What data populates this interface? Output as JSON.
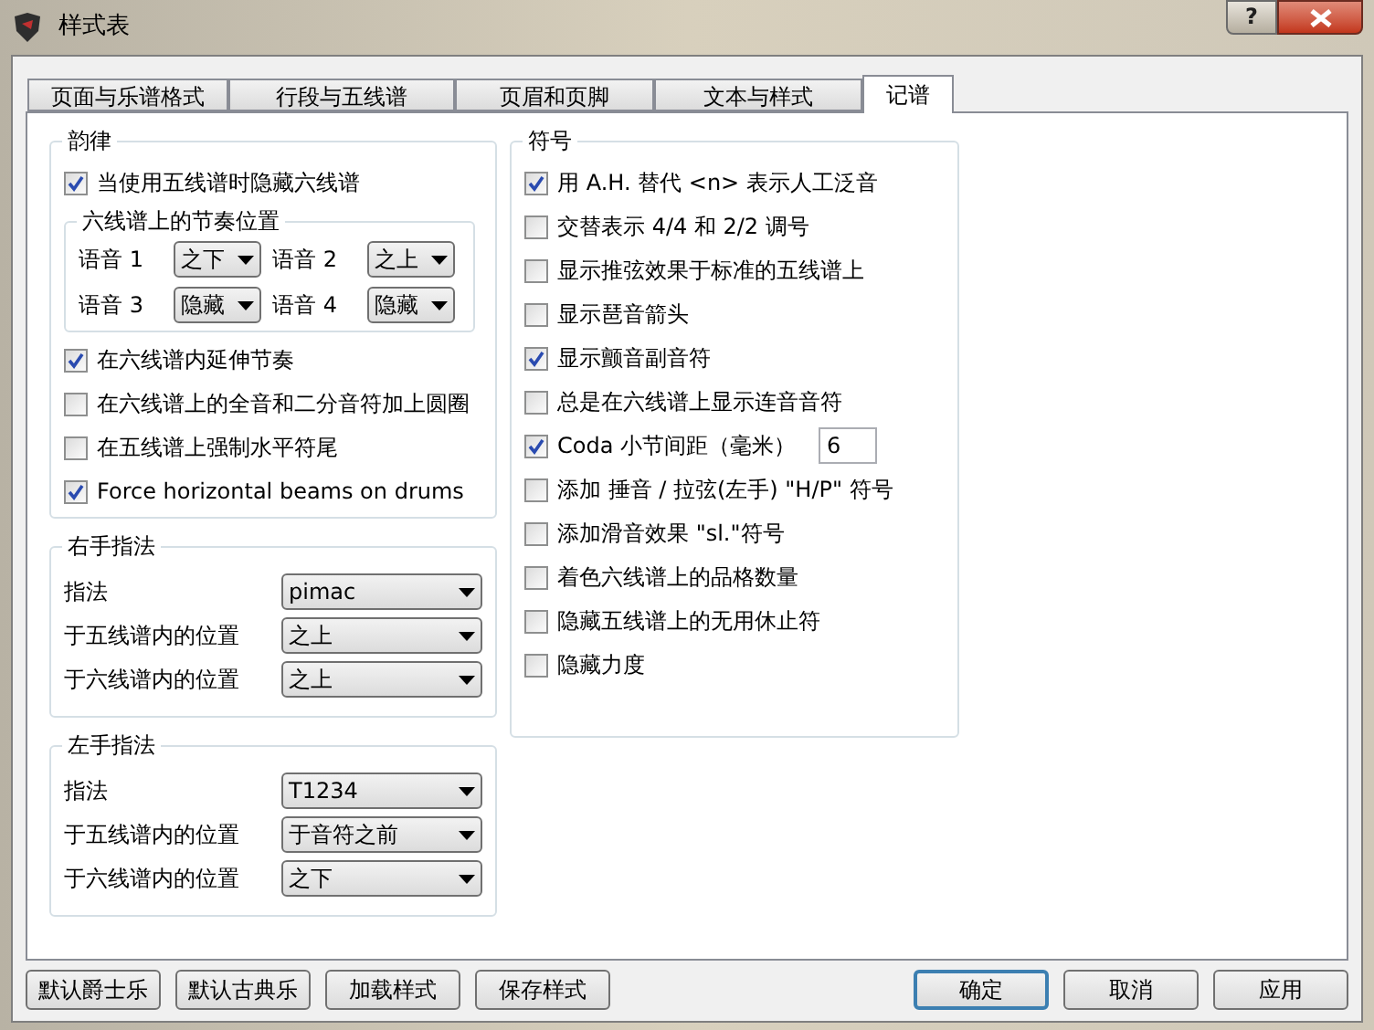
{
  "window": {
    "title": "样式表",
    "help": "?"
  },
  "tabs": [
    {
      "label": "页面与乐谱格式",
      "selected": false
    },
    {
      "label": "行段与五线谱",
      "selected": false
    },
    {
      "label": "页眉和页脚",
      "selected": false
    },
    {
      "label": "文本与样式",
      "selected": false
    },
    {
      "label": "记谱",
      "selected": true
    }
  ],
  "rhythm": {
    "title": "韵律",
    "hide_tab": {
      "label": "当使用五线谱时隐藏六线谱",
      "checked": true
    },
    "positions": {
      "title": "六线谱上的节奏位置",
      "voices": [
        {
          "label": "语音 1",
          "value": "之下"
        },
        {
          "label": "语音 2",
          "value": "之上"
        },
        {
          "label": "语音 3",
          "value": "隐藏"
        },
        {
          "label": "语音 4",
          "value": "隐藏"
        }
      ]
    },
    "options": [
      {
        "label": "在六线谱内延伸节奏",
        "checked": true
      },
      {
        "label": "在六线谱上的全音和二分音符加上圆圈",
        "checked": false
      },
      {
        "label": "在五线谱上强制水平符尾",
        "checked": false
      },
      {
        "label": "Force horizontal beams on drums",
        "checked": true
      }
    ]
  },
  "right_hand": {
    "title": "右手指法",
    "rows": [
      {
        "label": "指法",
        "value": "pimac"
      },
      {
        "label": "于五线谱内的位置",
        "value": "之上"
      },
      {
        "label": "于六线谱内的位置",
        "value": "之上"
      }
    ]
  },
  "left_hand": {
    "title": "左手指法",
    "rows": [
      {
        "label": "指法",
        "value": "T1234"
      },
      {
        "label": "于五线谱内的位置",
        "value": "于音符之前"
      },
      {
        "label": "于六线谱内的位置",
        "value": "之下"
      }
    ]
  },
  "symbols": {
    "title": "符号",
    "options": [
      {
        "kind": "checkbox",
        "label": "用 A.H. 替代 <n> 表示人工泛音",
        "checked": true
      },
      {
        "kind": "checkbox",
        "label": "交替表示 4/4 和 2/2 调号",
        "checked": false
      },
      {
        "kind": "checkbox",
        "label": "显示推弦效果于标准的五线谱上",
        "checked": false
      },
      {
        "kind": "checkbox",
        "label": "显示琶音箭头",
        "checked": false
      },
      {
        "kind": "checkbox",
        "label": "显示颤音副音符",
        "checked": true
      },
      {
        "kind": "checkbox",
        "label": "总是在六线谱上显示连音音符",
        "checked": false
      },
      {
        "kind": "number",
        "label": "Coda 小节间距（毫米）",
        "checked": true,
        "value": "6"
      },
      {
        "kind": "checkbox",
        "label": "添加 捶音 / 拉弦(左手) \"H/P\" 符号",
        "checked": false
      },
      {
        "kind": "checkbox",
        "label": "添加滑音效果 \"sl.\"符号",
        "checked": false
      },
      {
        "kind": "checkbox",
        "label": "着色六线谱上的品格数量",
        "checked": false
      },
      {
        "kind": "checkbox",
        "label": "隐藏五线谱上的无用休止符",
        "checked": false
      },
      {
        "kind": "checkbox",
        "label": "隐藏力度",
        "checked": false
      }
    ]
  },
  "buttons": [
    {
      "label": "默认爵士乐",
      "default": false
    },
    {
      "label": "默认古典乐",
      "default": false
    },
    {
      "label": "加载样式",
      "default": false
    },
    {
      "label": "保存样式",
      "default": false
    },
    {
      "label": "确定",
      "default": true
    },
    {
      "label": "取消",
      "default": false
    },
    {
      "label": "应用",
      "default": false
    }
  ]
}
